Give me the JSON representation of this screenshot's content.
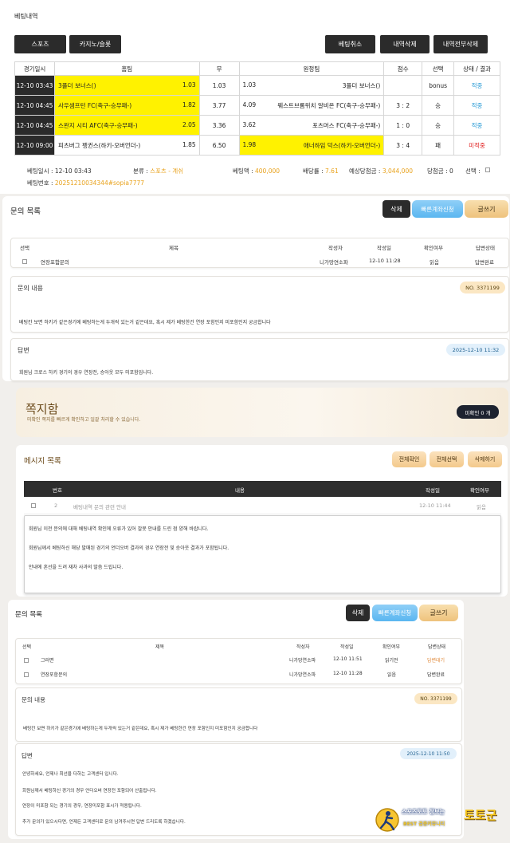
{
  "section1": {
    "title": "베팅내역",
    "btn_sports": "스포츠",
    "btn_casino": "카지노/슬롯",
    "btn_cancel": "베팅취소",
    "btn_delete": "내역삭제",
    "btn_delete_all": "내역전부삭제",
    "headers": [
      "경기일시",
      "홈팀",
      "무",
      "원정팀",
      "점수",
      "선택",
      "상태 / 결과"
    ],
    "rows": [
      {
        "date": "12-10 03:43",
        "home": "3폴더 보너스()",
        "home_odds": "1.03",
        "draw": "1.03",
        "away_odds": "1.03",
        "away": "3폴더 보너스()",
        "score": "",
        "pick": "bonus",
        "status": "적중"
      },
      {
        "date": "12-10 04:45",
        "home": "사우샘프턴 FC(축구-승무패-)",
        "home_odds": "1.82",
        "draw": "3.77",
        "away_odds": "4.09",
        "away": "웨스트브롬위치 알비온 FC(축구-승무패-)",
        "score": "3 : 2",
        "pick": "승",
        "status": "적중"
      },
      {
        "date": "12-10 04:45",
        "home": "스완지 시티 AFC(축구-승무패-)",
        "home_odds": "2.05",
        "draw": "3.36",
        "away_odds": "3.62",
        "away": "포츠머스 FC(축구-승무패-)",
        "score": "1 : 0",
        "pick": "승",
        "status": "적중"
      },
      {
        "date": "12-10 09:00",
        "home": "피츠버그 펭귄스(하키-오버언더-)",
        "home_odds": "1.85",
        "draw": "6.50",
        "away_odds": "1.98",
        "away": "애너하임 덕스(하키-오버언더-)",
        "score": "3 : 4",
        "pick": "패",
        "status": "미적중"
      }
    ],
    "bet_time_label": "베팅일시 :",
    "bet_time": "12-10 03:43",
    "category_label": "분류 :",
    "category": "스포츠 - 계쉬",
    "amount_label": "베팅액 :",
    "amount": "400,000",
    "rate_label": "배당률 :",
    "rate": "7.61",
    "expected_label": "예상당첨금 :",
    "expected": "3,044,000",
    "win_label": "당첨금 : 0",
    "select_label": "선택 :",
    "bet_no_label": "베팅번호 :",
    "bet_no": "20251210034344#sopia7777"
  },
  "inquiry1": {
    "title": "문의 목록",
    "btn_delete": "삭제",
    "btn_quick": "빠른계좌신청",
    "btn_write": "글쓰기",
    "headers": [
      "선택",
      "제목",
      "작성자",
      "작성일",
      "확인여부",
      "답변상태"
    ],
    "rows": [
      {
        "title": "연장포함문의",
        "author": "니가망연소파",
        "date": "12-10 11:28",
        "read": "읽음",
        "status": "답변완료"
      }
    ],
    "content_label": "문의 내용",
    "no_badge": "NO. 3371199",
    "content": "베팅칸 보면 하키가 같은경기에 베팅하는게 두개씩 있는거 같은데요, 혹시 제가 베팅한건 연장 포함인지 미포함인지 궁금합니다",
    "answer_label": "답변",
    "answer_date": "2025-12-10 11:32",
    "answer": "회원님 크로스 하키 경기의 경우 연장전, 승아웃 모두 미포함입니다."
  },
  "notes": {
    "title": "쪽지함",
    "subtitle": "미확인 쪽지를 빠르게 확인하고 일괄 처리할 수 있습니다.",
    "unread": "미확인 0 개",
    "list_title": "메시지 목록",
    "btn_read_all": "전체확인",
    "btn_select_all": "전체선택",
    "btn_delete": "삭제하기",
    "headers": [
      "번호",
      "내용",
      "작성일",
      "확인여부"
    ],
    "row": {
      "no": "2",
      "content": "베팅내역 문의 관련 안내",
      "date": "12-10 11:44",
      "status": "읽음"
    },
    "body": [
      "회원님 이전 문의에 대해 베팅내역 확인에 오류가 있어 잘못 안내를 드린 점 양해 바랍니다.",
      "회원님께서 베팅하신 해당 발매된 경기의 언더오버 결과의 경우 연장전 및 승아웃 결과가 포함됩니다.",
      "안내에 혼선을 드려 재차 사과의 말씀 드립니다."
    ]
  },
  "inquiry2": {
    "title": "문의 목록",
    "btn_delete": "삭제",
    "btn_quick": "빠른계좌신청",
    "btn_write": "글쓰기",
    "headers": [
      "선택",
      "제목",
      "작성자",
      "작성일",
      "확인여부",
      "답변상태"
    ],
    "rows": [
      {
        "title": "그러면",
        "author": "니가망연소파",
        "date": "12-10 11:51",
        "read": "읽기전",
        "status": "답변대기"
      },
      {
        "title": "연장포함문의",
        "author": "니가망연소파",
        "date": "12-10 11:28",
        "read": "읽음",
        "status": "답변완료"
      }
    ],
    "content_label": "문의 내용",
    "no_badge": "NO. 3371199",
    "content": "베팅칸 보면 하키가 같은경기에 베팅하는게 두개씩 있는거 같은데요, 혹시 제가 베팅한건 연장 포함인지 미포함인지 궁금합니다",
    "answer_label": "답변",
    "answer_date": "2025-12-10 11:50",
    "answer": [
      "안녕하세요, 언제나 최선을 다하는 고객센터 입니다.",
      "회원님께서 베팅하신 경기의 경우 언더오버 연장전 포함되어 산출됩니다.",
      "연장이 미포함 되는 경기의 경우, 연장미포함 표시가 적용됩니다.",
      "추가 문의가 있으시다면, 언제든 고객센터로 문의 남겨주시면 답변 드리도록 하겠습니다."
    ]
  },
  "watermark": {
    "line1": "스포츠토토 정보는",
    "line2": "BEST 검증커뮤니티",
    "brand": "토토군"
  }
}
